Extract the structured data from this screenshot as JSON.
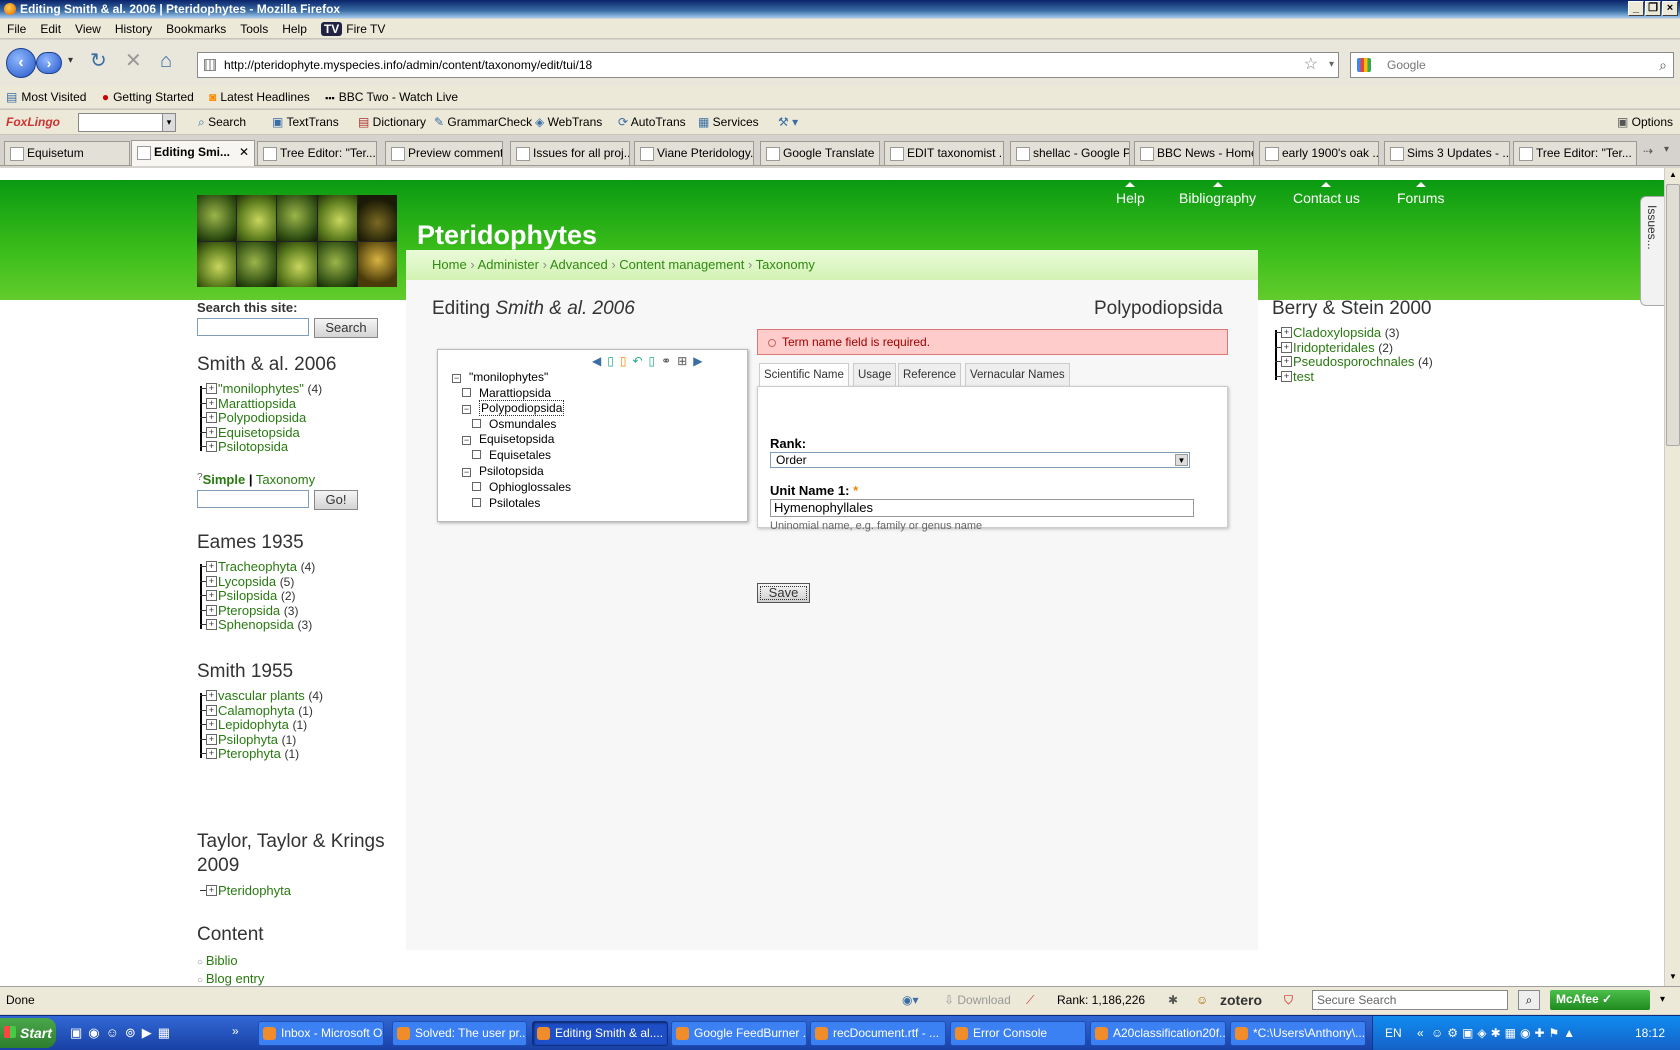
{
  "window": {
    "title": "Editing Smith & al. 2006 | Pteridophytes - Mozilla Firefox"
  },
  "menu": [
    "File",
    "Edit",
    "View",
    "History",
    "Bookmarks",
    "Tools",
    "Help",
    "Fire TV"
  ],
  "nav": {
    "url": "http://pteridophyte.myspecies.info/admin/content/taxonomy/edit/tui/18",
    "search_placeholder": "Google"
  },
  "bookmarks": [
    "Most Visited",
    "Getting Started",
    "Latest Headlines",
    "BBC Two - Watch Live"
  ],
  "foxbar": {
    "brand": "FoxLingo",
    "items": [
      "Search",
      "TextTrans",
      "Dictionary",
      "GrammarCheck",
      "WebTrans",
      "AutoTrans",
      "Services"
    ],
    "options": "Options"
  },
  "tabs": [
    "Equisetum",
    "Editing Smi...",
    "Tree Editor: \"Ter...",
    "Preview comment...",
    "Issues for all proj...",
    "Viane Pteridology...",
    "Google Translate",
    "EDIT taxonomist ...",
    "shellac - Google P...",
    "BBC News - Home",
    "early 1900's oak ...",
    "Sims 3 Updates - ...",
    "Tree Editor: \"Ter..."
  ],
  "site": {
    "name": "Pteridophytes",
    "topnav": [
      "Help",
      "Bibliography",
      "Contact us",
      "Forums"
    ],
    "breadcrumb": [
      "Home",
      "Administer",
      "Advanced",
      "Content management",
      "Taxonomy"
    ],
    "issues_tab": "Issues..."
  },
  "sidebar": {
    "search_label": "Search this site:",
    "search_button": "Search",
    "smith2006": {
      "title": "Smith & al. 2006",
      "items": [
        {
          "name": "\"monilophytes\"",
          "count": "(4)"
        },
        {
          "name": "Marattiopsida",
          "count": ""
        },
        {
          "name": "Polypodiopsida",
          "count": ""
        },
        {
          "name": "Equisetopsida",
          "count": ""
        },
        {
          "name": "Psilotopsida",
          "count": ""
        }
      ]
    },
    "simple": "Simple",
    "pipe": "|",
    "taxonomy": "Taxonomy",
    "go": "Go!",
    "eames": {
      "title": "Eames 1935",
      "items": [
        {
          "name": "Tracheophyta",
          "count": "(4)"
        },
        {
          "name": "Lycopsida",
          "count": "(5)"
        },
        {
          "name": "Psilopsida",
          "count": "(2)"
        },
        {
          "name": "Pteropsida",
          "count": "(3)"
        },
        {
          "name": "Sphenopsida",
          "count": "(3)"
        }
      ]
    },
    "smith1955": {
      "title": "Smith 1955",
      "items": [
        {
          "name": "vascular plants",
          "count": "(4)"
        },
        {
          "name": "Calamophyta",
          "count": "(1)"
        },
        {
          "name": "Lepidophyta",
          "count": "(1)"
        },
        {
          "name": "Psilophyta",
          "count": "(1)"
        },
        {
          "name": "Pterophyta",
          "count": "(1)"
        }
      ]
    },
    "taylor": {
      "title1": "Taylor, Taylor & Krings",
      "title2": "2009",
      "items": [
        {
          "name": "Pteridophyta",
          "count": ""
        }
      ]
    },
    "content": {
      "title": "Content",
      "items": [
        "Biblio",
        "Blog entry"
      ]
    }
  },
  "main": {
    "editing": "Editing",
    "vocab": "Smith & al. 2006",
    "term": "Polypodiopsida",
    "tree": [
      "\"monilophytes\"",
      "Marattiopsida",
      "Polypodiopsida",
      "Osmundales",
      "Equisetopsida",
      "Equisetales",
      "Psilotopsida",
      "Ophioglossales",
      "Psilotales"
    ],
    "error": "Term name field is required.",
    "form_tabs": [
      "Scientific Name",
      "Usage",
      "Reference",
      "Vernacular Names"
    ],
    "rank_label": "Rank:",
    "rank_value": "Order",
    "unit_label": "Unit Name 1:",
    "required": "*",
    "unit_value": "Hymenophyllales",
    "unit_hint": "Uninomial name, e.g. family or genus name",
    "save": "Save"
  },
  "rightbar": {
    "title": "Berry & Stein 2000",
    "items": [
      {
        "name": "Cladoxylopsida",
        "count": "(3)"
      },
      {
        "name": "Iridopteridales",
        "count": "(2)"
      },
      {
        "name": "Pseudosporochnales",
        "count": "(4)"
      },
      {
        "name": "test",
        "count": ""
      }
    ]
  },
  "status": {
    "text": "Done",
    "download": "Download",
    "rank": "Rank: 1,186,226",
    "zotero": "zotero",
    "secure_search": "Secure Search",
    "mcafee": "McAfee"
  },
  "taskbar": {
    "start": "Start",
    "tasks": [
      "Inbox - Microsoft O...",
      "Solved: The user pr...",
      "Editing Smith & al....",
      "Google FeedBurner ...",
      "recDocument.rtf - ...",
      "Error Console",
      "A20classification20f...",
      "*C:\\Users\\Anthony\\..."
    ],
    "lang": "EN",
    "time": "18:12"
  }
}
